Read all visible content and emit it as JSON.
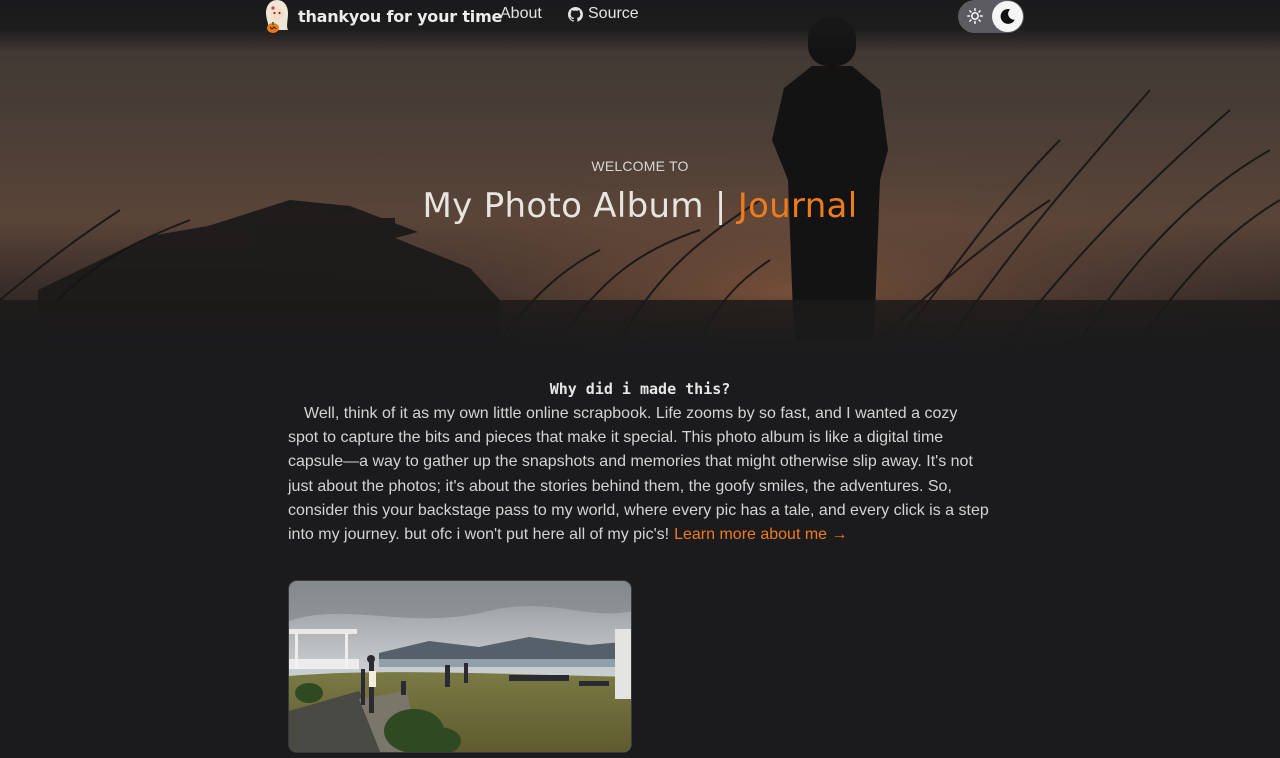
{
  "navbar": {
    "brand_title": "thankyou for your time",
    "links": [
      {
        "label": "About"
      },
      {
        "label": "Source",
        "icon": "github-icon"
      }
    ],
    "theme_toggle": {
      "left_icon": "sun-icon",
      "active_icon": "moon-icon",
      "active_mode": "dark"
    }
  },
  "hero": {
    "kicker": "WELCOME TO",
    "title_main": "My Photo Album",
    "title_separator": "|",
    "title_accent": "Journal"
  },
  "intro": {
    "heading": "Why did i made this?",
    "body": "Well, think of it as my own little online scrapbook. Life zooms by so fast, and I wanted a cozy spot to capture the bits and pieces that make it special. This photo album is like a digital time capsule—a way to gather up the snapshots and memories that might otherwise slip away. It's not just about the photos; it's about the stories behind them, the goofy smiles, the adventures. So, consider this your backstage pass to my world, where every pic has a tale, and every click is a step into my journey. but ofc i won't put here all of my pic's!",
    "link_label": "Learn more about me →"
  },
  "gallery": {
    "items": [
      {
        "kind": "photo",
        "subject": "hillside-viewpoint-lake"
      }
    ]
  },
  "colors": {
    "background": "#1b1b1d",
    "accent": "#f07a1e",
    "text": "#d3d3d3",
    "toggle_track": "#5b5b61"
  }
}
